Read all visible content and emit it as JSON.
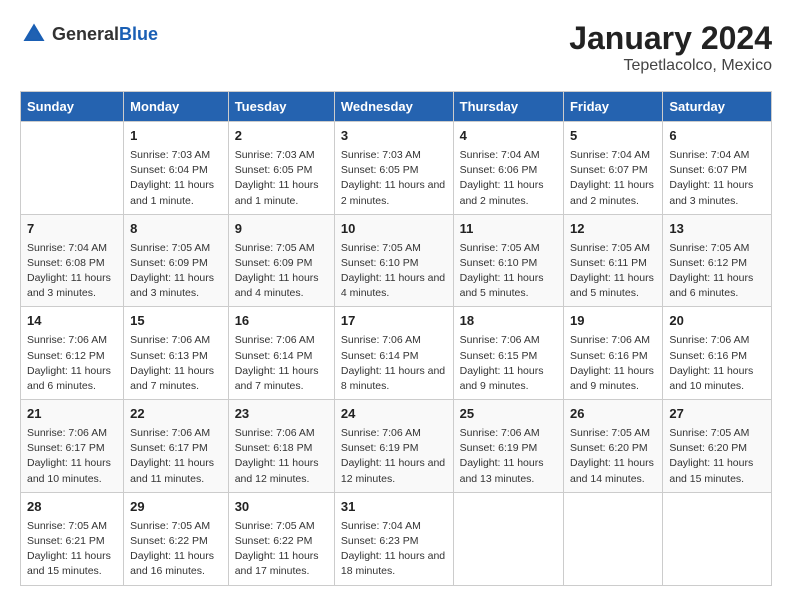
{
  "header": {
    "logo_general": "General",
    "logo_blue": "Blue",
    "title": "January 2024",
    "subtitle": "Tepetlacolco, Mexico"
  },
  "columns": [
    "Sunday",
    "Monday",
    "Tuesday",
    "Wednesday",
    "Thursday",
    "Friday",
    "Saturday"
  ],
  "weeks": [
    [
      {
        "day": "",
        "sunrise": "",
        "sunset": "",
        "daylight": ""
      },
      {
        "day": "1",
        "sunrise": "Sunrise: 7:03 AM",
        "sunset": "Sunset: 6:04 PM",
        "daylight": "Daylight: 11 hours and 1 minute."
      },
      {
        "day": "2",
        "sunrise": "Sunrise: 7:03 AM",
        "sunset": "Sunset: 6:05 PM",
        "daylight": "Daylight: 11 hours and 1 minute."
      },
      {
        "day": "3",
        "sunrise": "Sunrise: 7:03 AM",
        "sunset": "Sunset: 6:05 PM",
        "daylight": "Daylight: 11 hours and 2 minutes."
      },
      {
        "day": "4",
        "sunrise": "Sunrise: 7:04 AM",
        "sunset": "Sunset: 6:06 PM",
        "daylight": "Daylight: 11 hours and 2 minutes."
      },
      {
        "day": "5",
        "sunrise": "Sunrise: 7:04 AM",
        "sunset": "Sunset: 6:07 PM",
        "daylight": "Daylight: 11 hours and 2 minutes."
      },
      {
        "day": "6",
        "sunrise": "Sunrise: 7:04 AM",
        "sunset": "Sunset: 6:07 PM",
        "daylight": "Daylight: 11 hours and 3 minutes."
      }
    ],
    [
      {
        "day": "7",
        "sunrise": "Sunrise: 7:04 AM",
        "sunset": "Sunset: 6:08 PM",
        "daylight": "Daylight: 11 hours and 3 minutes."
      },
      {
        "day": "8",
        "sunrise": "Sunrise: 7:05 AM",
        "sunset": "Sunset: 6:09 PM",
        "daylight": "Daylight: 11 hours and 3 minutes."
      },
      {
        "day": "9",
        "sunrise": "Sunrise: 7:05 AM",
        "sunset": "Sunset: 6:09 PM",
        "daylight": "Daylight: 11 hours and 4 minutes."
      },
      {
        "day": "10",
        "sunrise": "Sunrise: 7:05 AM",
        "sunset": "Sunset: 6:10 PM",
        "daylight": "Daylight: 11 hours and 4 minutes."
      },
      {
        "day": "11",
        "sunrise": "Sunrise: 7:05 AM",
        "sunset": "Sunset: 6:10 PM",
        "daylight": "Daylight: 11 hours and 5 minutes."
      },
      {
        "day": "12",
        "sunrise": "Sunrise: 7:05 AM",
        "sunset": "Sunset: 6:11 PM",
        "daylight": "Daylight: 11 hours and 5 minutes."
      },
      {
        "day": "13",
        "sunrise": "Sunrise: 7:05 AM",
        "sunset": "Sunset: 6:12 PM",
        "daylight": "Daylight: 11 hours and 6 minutes."
      }
    ],
    [
      {
        "day": "14",
        "sunrise": "Sunrise: 7:06 AM",
        "sunset": "Sunset: 6:12 PM",
        "daylight": "Daylight: 11 hours and 6 minutes."
      },
      {
        "day": "15",
        "sunrise": "Sunrise: 7:06 AM",
        "sunset": "Sunset: 6:13 PM",
        "daylight": "Daylight: 11 hours and 7 minutes."
      },
      {
        "day": "16",
        "sunrise": "Sunrise: 7:06 AM",
        "sunset": "Sunset: 6:14 PM",
        "daylight": "Daylight: 11 hours and 7 minutes."
      },
      {
        "day": "17",
        "sunrise": "Sunrise: 7:06 AM",
        "sunset": "Sunset: 6:14 PM",
        "daylight": "Daylight: 11 hours and 8 minutes."
      },
      {
        "day": "18",
        "sunrise": "Sunrise: 7:06 AM",
        "sunset": "Sunset: 6:15 PM",
        "daylight": "Daylight: 11 hours and 9 minutes."
      },
      {
        "day": "19",
        "sunrise": "Sunrise: 7:06 AM",
        "sunset": "Sunset: 6:16 PM",
        "daylight": "Daylight: 11 hours and 9 minutes."
      },
      {
        "day": "20",
        "sunrise": "Sunrise: 7:06 AM",
        "sunset": "Sunset: 6:16 PM",
        "daylight": "Daylight: 11 hours and 10 minutes."
      }
    ],
    [
      {
        "day": "21",
        "sunrise": "Sunrise: 7:06 AM",
        "sunset": "Sunset: 6:17 PM",
        "daylight": "Daylight: 11 hours and 10 minutes."
      },
      {
        "day": "22",
        "sunrise": "Sunrise: 7:06 AM",
        "sunset": "Sunset: 6:17 PM",
        "daylight": "Daylight: 11 hours and 11 minutes."
      },
      {
        "day": "23",
        "sunrise": "Sunrise: 7:06 AM",
        "sunset": "Sunset: 6:18 PM",
        "daylight": "Daylight: 11 hours and 12 minutes."
      },
      {
        "day": "24",
        "sunrise": "Sunrise: 7:06 AM",
        "sunset": "Sunset: 6:19 PM",
        "daylight": "Daylight: 11 hours and 12 minutes."
      },
      {
        "day": "25",
        "sunrise": "Sunrise: 7:06 AM",
        "sunset": "Sunset: 6:19 PM",
        "daylight": "Daylight: 11 hours and 13 minutes."
      },
      {
        "day": "26",
        "sunrise": "Sunrise: 7:05 AM",
        "sunset": "Sunset: 6:20 PM",
        "daylight": "Daylight: 11 hours and 14 minutes."
      },
      {
        "day": "27",
        "sunrise": "Sunrise: 7:05 AM",
        "sunset": "Sunset: 6:20 PM",
        "daylight": "Daylight: 11 hours and 15 minutes."
      }
    ],
    [
      {
        "day": "28",
        "sunrise": "Sunrise: 7:05 AM",
        "sunset": "Sunset: 6:21 PM",
        "daylight": "Daylight: 11 hours and 15 minutes."
      },
      {
        "day": "29",
        "sunrise": "Sunrise: 7:05 AM",
        "sunset": "Sunset: 6:22 PM",
        "daylight": "Daylight: 11 hours and 16 minutes."
      },
      {
        "day": "30",
        "sunrise": "Sunrise: 7:05 AM",
        "sunset": "Sunset: 6:22 PM",
        "daylight": "Daylight: 11 hours and 17 minutes."
      },
      {
        "day": "31",
        "sunrise": "Sunrise: 7:04 AM",
        "sunset": "Sunset: 6:23 PM",
        "daylight": "Daylight: 11 hours and 18 minutes."
      },
      {
        "day": "",
        "sunrise": "",
        "sunset": "",
        "daylight": ""
      },
      {
        "day": "",
        "sunrise": "",
        "sunset": "",
        "daylight": ""
      },
      {
        "day": "",
        "sunrise": "",
        "sunset": "",
        "daylight": ""
      }
    ]
  ]
}
